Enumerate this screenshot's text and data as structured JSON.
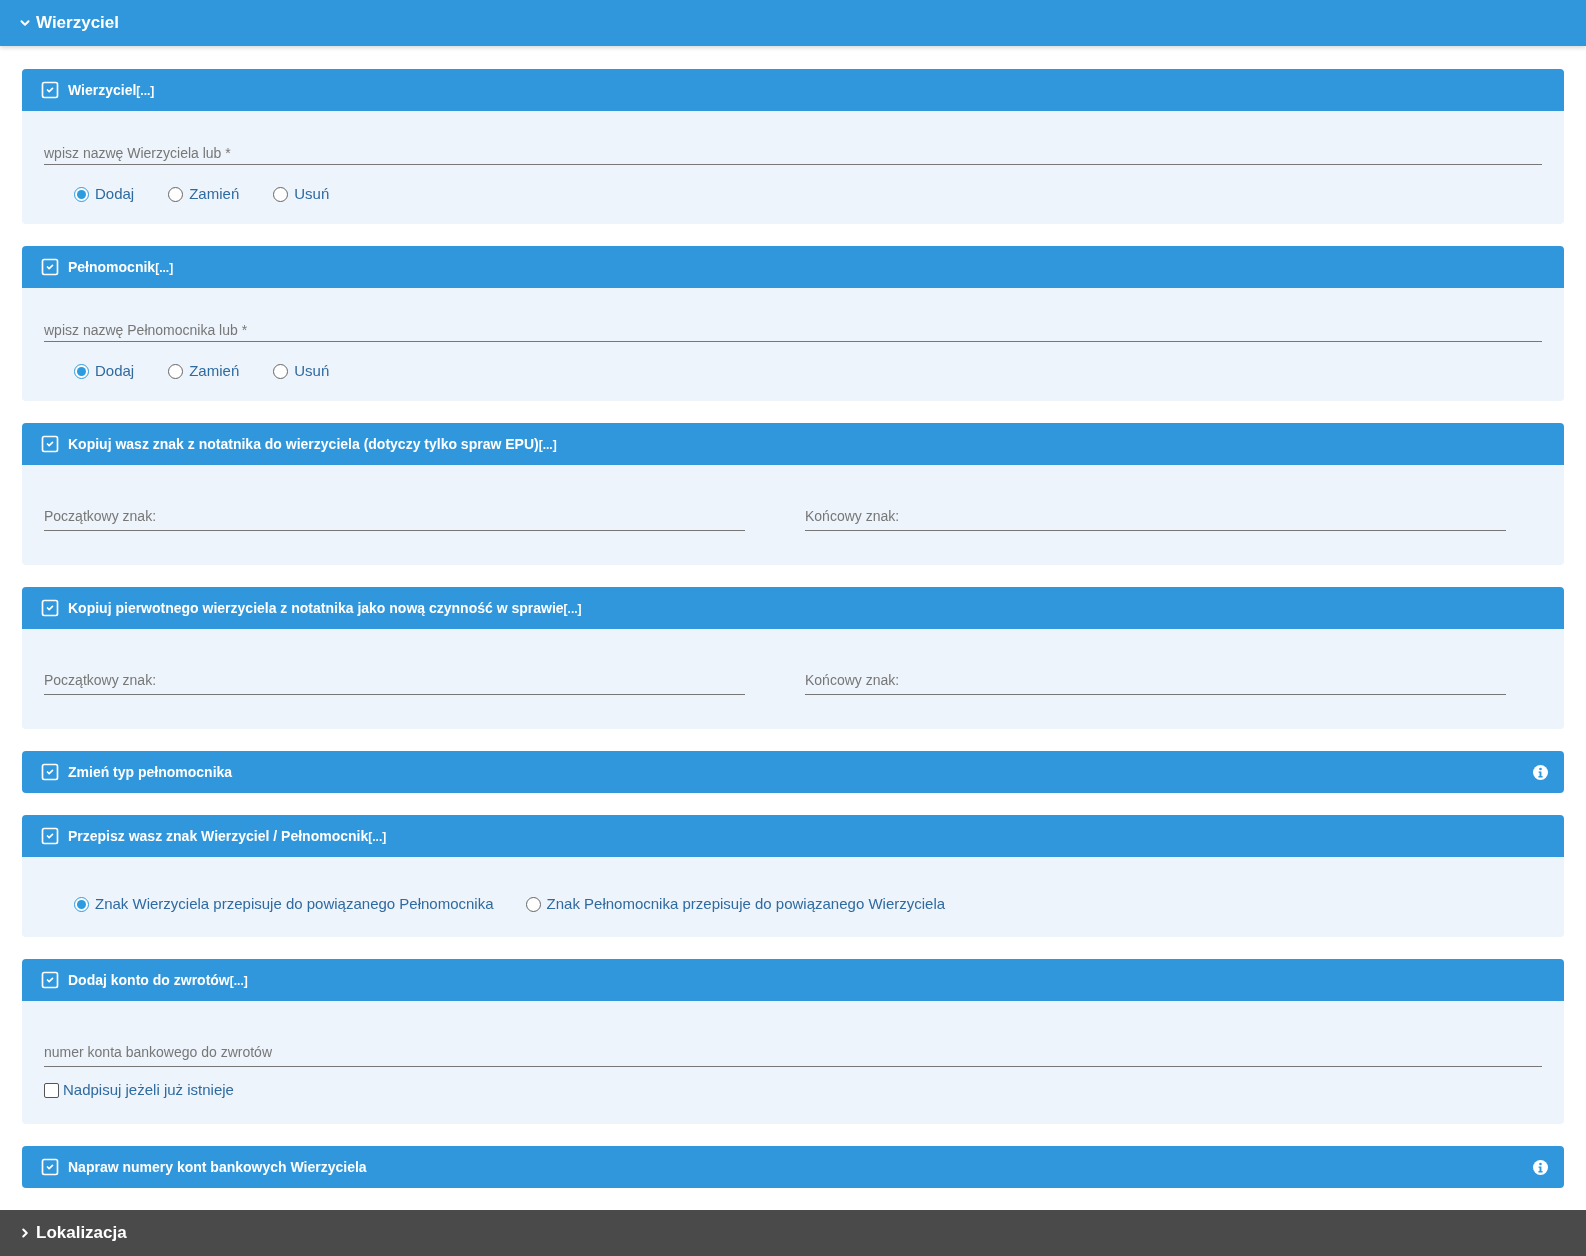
{
  "sections": [
    {
      "title": "Wierzyciel",
      "expanded": true,
      "cards": [
        {
          "kind": "field_radios",
          "checked": true,
          "title": "Wierzyciel",
          "more": "[...]",
          "placeholder": "wpisz nazwę Wierzyciela lub *",
          "options": [
            {
              "label": "Dodaj",
              "selected": true
            },
            {
              "label": "Zamień",
              "selected": false
            },
            {
              "label": "Usuń",
              "selected": false
            }
          ]
        },
        {
          "kind": "field_radios",
          "checked": true,
          "title": "Pełnomocnik",
          "more": "[...]",
          "placeholder": "wpisz nazwę Pełnomocnika lub *",
          "options": [
            {
              "label": "Dodaj",
              "selected": true
            },
            {
              "label": "Zamień",
              "selected": false
            },
            {
              "label": "Usuń",
              "selected": false
            }
          ]
        },
        {
          "kind": "two_fields",
          "checked": true,
          "title": "Kopiuj wasz znak z notatnika do wierzyciela (dotyczy tylko spraw EPU)",
          "more": "[...]",
          "fields": [
            {
              "placeholder": "Początkowy znak:"
            },
            {
              "placeholder": "Końcowy znak:"
            }
          ]
        },
        {
          "kind": "two_fields",
          "checked": true,
          "title": "Kopiuj pierwotnego wierzyciela z notatnika jako nową czynność w sprawie",
          "more": "[...]",
          "fields": [
            {
              "placeholder": "Początkowy znak:"
            },
            {
              "placeholder": "Końcowy znak:"
            }
          ]
        },
        {
          "kind": "plain",
          "checked": true,
          "title": "Zmień typ pełnomocnika",
          "info": true
        },
        {
          "kind": "radios",
          "checked": true,
          "title": "Przepisz wasz znak Wierzyciel / Pełnomocnik",
          "more": "[...]",
          "options": [
            {
              "label": "Znak Wierzyciela przepisuje do powiązanego Pełnomocnika",
              "selected": true
            },
            {
              "label": "Znak Pełnomocnika przepisuje do powiązanego Wierzyciela",
              "selected": false
            }
          ]
        },
        {
          "kind": "field_checkbox",
          "checked": true,
          "title": "Dodaj konto do zwrotów",
          "more": "[...]",
          "placeholder": "numer konta bankowego do zwrotów",
          "checkbox": {
            "label": "Nadpisuj jeżeli już istnieje",
            "checked": false
          }
        },
        {
          "kind": "plain",
          "checked": true,
          "title": "Napraw numery kont bankowych Wierzyciela",
          "info": true
        }
      ]
    },
    {
      "title": "Lokalizacja",
      "expanded": false
    }
  ]
}
